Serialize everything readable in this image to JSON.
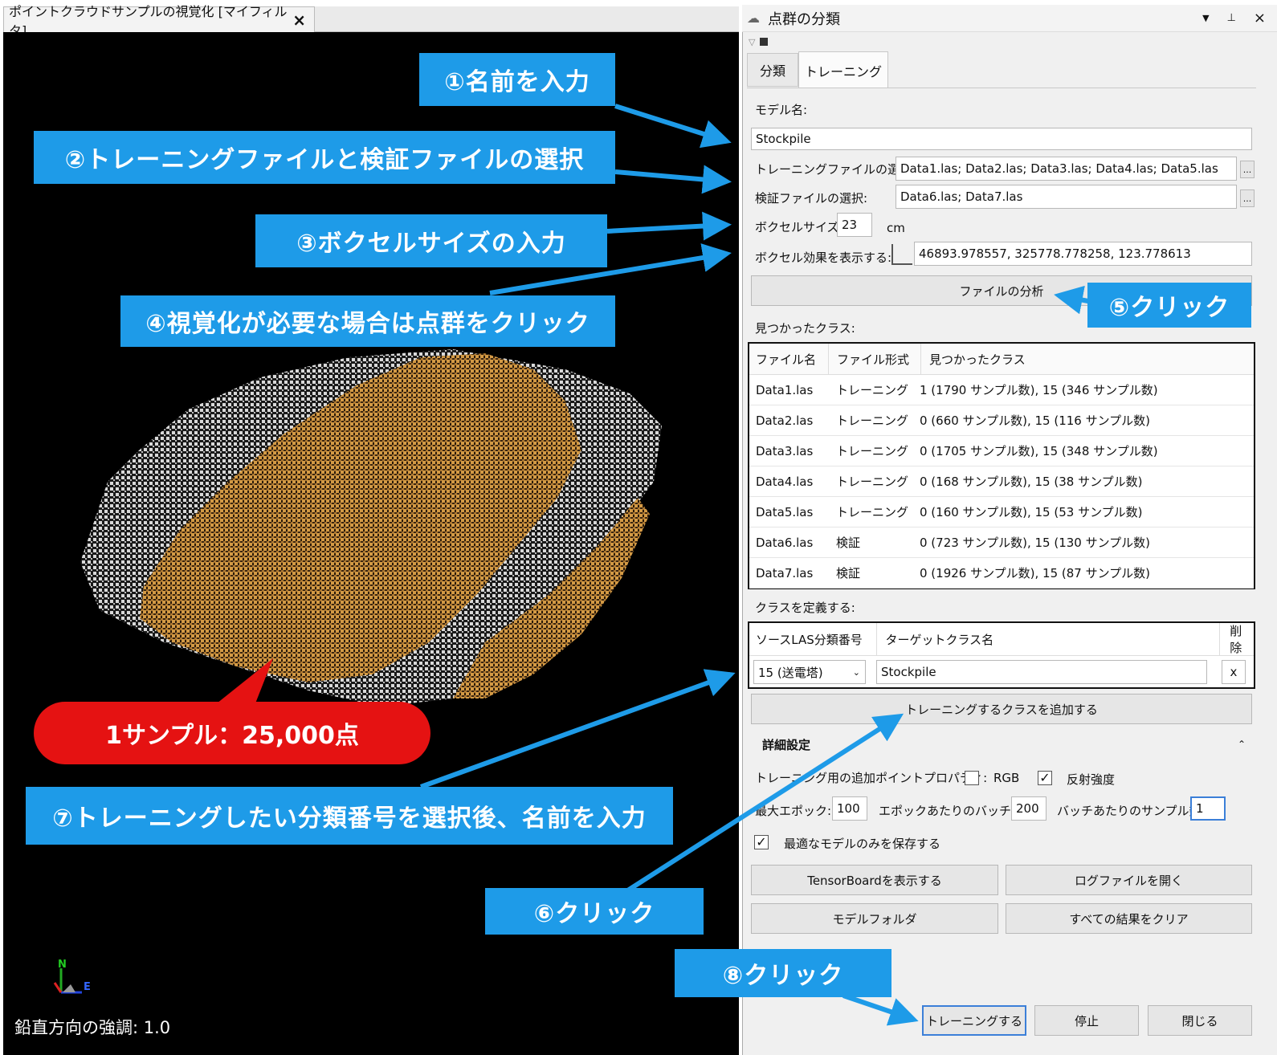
{
  "viewer": {
    "tab_title": "ポイントクラウドサンプルの視覚化 [マイフィルタ]",
    "close_glyph": "×",
    "emphasis": "鉛直方向の強調: 1.0",
    "axis_n": "N",
    "axis_e": "E"
  },
  "panel": {
    "title": "点群の分類",
    "tabs": [
      {
        "label": "分類"
      },
      {
        "label": "トレーニング"
      }
    ],
    "model_label": "モデル名:",
    "model_value": "Stockpile",
    "train_label": "トレーニングファイルの選択:",
    "train_value": "Data1.las; Data2.las; Data3.las; Data4.las; Data5.las",
    "valid_label": "検証ファイルの選択:",
    "valid_value": "Data6.las; Data7.las",
    "browse": "...",
    "voxel_label": "ボクセルサイズ:",
    "voxel_value": "23",
    "voxel_unit": "cm",
    "voxel_effect_label": "ボクセル効果を表示する:",
    "voxel_effect_value": "46893.978557, 325778.778258, 123.778613",
    "analyze_button": "ファイルの分析",
    "found_label": "見つかったクラス:",
    "found_headers": [
      "ファイル名",
      "ファイル形式",
      "見つかったクラス"
    ],
    "found_rows": [
      [
        "Data1.las",
        "トレーニング",
        "1 (1790 サンプル数), 15 (346 サンプル数)"
      ],
      [
        "Data2.las",
        "トレーニング",
        "0 (660 サンプル数), 15 (116 サンプル数)"
      ],
      [
        "Data3.las",
        "トレーニング",
        "0 (1705 サンプル数), 15 (348 サンプル数)"
      ],
      [
        "Data4.las",
        "トレーニング",
        "0 (168 サンプル数), 15 (38 サンプル数)"
      ],
      [
        "Data5.las",
        "トレーニング",
        "0 (160 サンプル数), 15 (53 サンプル数)"
      ],
      [
        "Data6.las",
        "検証",
        "0 (723 サンプル数), 15 (130 サンプル数)"
      ],
      [
        "Data7.las",
        "検証",
        "0 (1926 サンプル数), 15 (87 サンプル数)"
      ]
    ],
    "define_label": "クラスを定義する:",
    "define_headers": [
      "ソースLAS分類番号",
      "ターゲットクラス名",
      "削除"
    ],
    "define_source": "15 (送電塔)",
    "define_target": "Stockpile",
    "define_delete": "x",
    "add_class_button": "トレーニングするクラスを追加する",
    "advanced_title": "詳細設定",
    "extra_props_label": "トレーニング用の追加ポイントプロパティ:",
    "rgb_label": "RGB",
    "rgb_checked": false,
    "intensity_label": "反射強度",
    "intensity_checked": true,
    "max_epoch_label": "最大エポック:",
    "max_epoch_value": "100",
    "batches_label": "エポックあたりのバッチ数:",
    "batches_value": "200",
    "samples_label": "バッチあたりのサンプル数:",
    "samples_value": "1",
    "save_best_label": "最適なモデルのみを保存する",
    "save_best_checked": true,
    "tensorboard_button": "TensorBoardを表示する",
    "log_button": "ログファイルを開く",
    "model_folder_button": "モデルフォルダ",
    "clear_button": "すべての結果をクリア",
    "train_button": "トレーニングする",
    "stop_button": "停止",
    "close_button": "閉じる"
  },
  "callouts": {
    "c1": "①名前を入力",
    "c2": "②トレーニングファイルと検証ファイルの選択",
    "c3": "③ボクセルサイズの入力",
    "c4": "④視覚化が必要な場合は点群をクリック",
    "c5": "⑤クリック",
    "c6": "⑥クリック",
    "c7": "⑦トレーニングしたい分類番号を選択後、名前を入力",
    "c8": "⑧クリック",
    "sample": "1サンプル：25,000点"
  },
  "colors": {
    "callout": "#1e9be8",
    "sample": "#e51212",
    "stockpile": "#c8903c",
    "ground": "#d8d8d8"
  }
}
